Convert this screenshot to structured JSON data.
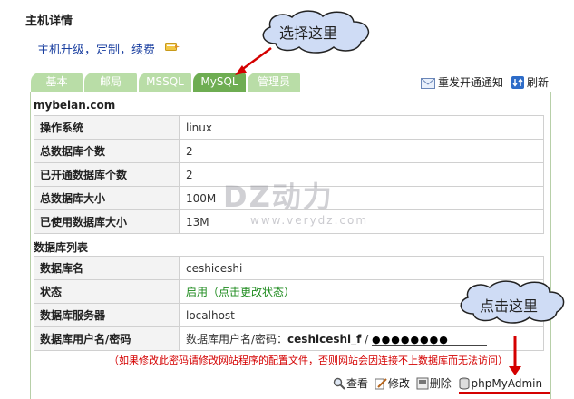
{
  "page": {
    "title": "主机详情",
    "upgrade_link": "主机升级，定制，续费",
    "host": "mybeian.com",
    "section_db_list": "数据库列表"
  },
  "tabs": [
    {
      "label": "基本"
    },
    {
      "label": "邮局"
    },
    {
      "label": "MSSQL"
    },
    {
      "label": "MySQL"
    },
    {
      "label": "管理员"
    }
  ],
  "active_tab": "MySQL",
  "actions_top": {
    "resend": "重发开通通知",
    "refresh": "刷新"
  },
  "summary": [
    {
      "label": "操作系统",
      "value": "linux"
    },
    {
      "label": "总数据库个数",
      "value": "2"
    },
    {
      "label": "已开通数据库个数",
      "value": "2"
    },
    {
      "label": "总数据库大小",
      "value": "100M"
    },
    {
      "label": "已使用数据库大小",
      "value": "13M"
    }
  ],
  "db": {
    "name_label": "数据库名",
    "name_value": "ceshiceshi",
    "status_label": "状态",
    "status_value": "启用（点击更改状态）",
    "server_label": "数据库服务器",
    "server_value": "localhost",
    "cred_label": "数据库用户名/密码",
    "cred_prefix": "数据库用户名/密码：",
    "cred_user": "ceshiceshi_f",
    "cred_sep": " / ",
    "cred_password": "●●●●●●●●"
  },
  "warning": "（如果修改此密码请修改网站程序的配置文件，否则网站会因连接不上数据库而无法访问）",
  "row_actions": {
    "view": "查看",
    "edit": "修改",
    "delete": "删除",
    "phpmyadmin": "phpMyAdmin"
  },
  "watermark": {
    "text": "DZ动力",
    "url": "www.verydz.com"
  },
  "callouts": {
    "top": "选择这里",
    "bottom": "点击这里"
  },
  "colors": {
    "tab": "#b9dda7",
    "tab_active": "#6ead52",
    "link": "#1a3fa0",
    "warning": "#d40000",
    "status_green": "#1e8b1e",
    "callout_fill": "#cfdcf5"
  }
}
